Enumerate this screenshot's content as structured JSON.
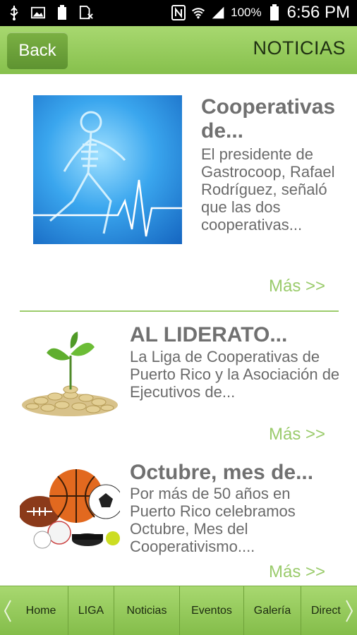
{
  "status_bar": {
    "icons_left": [
      "usb-icon",
      "image-icon",
      "battery-100-icon",
      "sim-x-icon"
    ],
    "icons_right": [
      "nfc-icon",
      "wifi-icon",
      "signal-icon"
    ],
    "battery": "100%",
    "time": "6:56 PM"
  },
  "header": {
    "back_label": "Back",
    "title": "NOTICIAS"
  },
  "articles": [
    {
      "title": "Cooperativas de...",
      "body": "El presidente de Gastrocoop, Rafael Rodríguez, señaló que las dos cooperativas...",
      "more": "Más >>",
      "image": "xray-runner-image"
    },
    {
      "title": "AL LIDERATO...",
      "body": "La Liga de Cooperativas de Puerto Rico y la Asociación de Ejecutivos de...",
      "more": "Más >>",
      "image": "plant-coins-image"
    },
    {
      "title": "Octubre, mes de...",
      "body": "Por más de 50 años en Puerto Rico celebramos Octubre, Mes del Cooperativismo....",
      "more": "Más >>",
      "image": "sports-balls-image"
    }
  ],
  "bottom_nav": {
    "tabs": [
      "Home",
      "LIGA",
      "Noticias",
      "Eventos",
      "Galería",
      "Direct"
    ]
  },
  "colors": {
    "accent_green": "#86c04c",
    "more_link": "#9acb6b",
    "title_gray": "#707070"
  }
}
